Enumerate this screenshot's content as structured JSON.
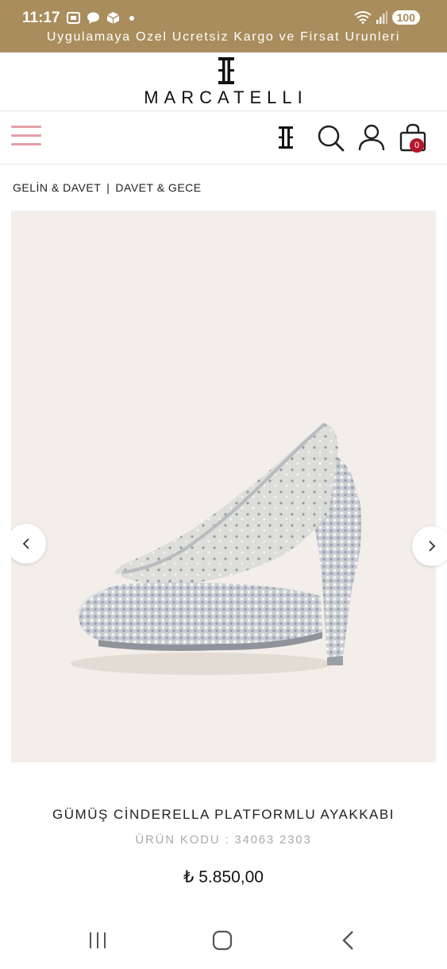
{
  "status_bar": {
    "time": "11:17",
    "battery": "100",
    "icons_left": [
      "screenshot-icon",
      "chat-icon",
      "package-icon"
    ],
    "icons_right": [
      "wifi-icon",
      "signal-icon"
    ]
  },
  "promo": {
    "text": "Uygulamaya Ozel Ucretsiz Kargo ve Firsat Urunleri"
  },
  "brand": {
    "name": "MARCATELLI",
    "accent_color": "#a98d5c",
    "menu_color": "#e2a1a7",
    "badge_color": "#b5172a"
  },
  "nav": {
    "cart_count": "0",
    "icons": [
      "hamburger-menu-icon",
      "brand-monogram-icon",
      "search-icon",
      "account-icon",
      "shopping-bag-icon"
    ]
  },
  "breadcrumb": {
    "items": [
      "GELİN & DAVET",
      "DAVET & GECE"
    ],
    "separator": "|"
  },
  "product": {
    "name": "GÜMÜŞ CİNDERELLA PLATFORMLU AYAKKABI",
    "code": "ÜRÜN KODU : 34063 2303",
    "price": "₺ 5.850,00"
  },
  "system_nav": {
    "icons": [
      "recent-apps-icon",
      "home-icon",
      "back-icon"
    ]
  }
}
